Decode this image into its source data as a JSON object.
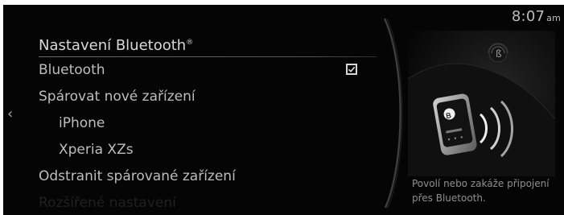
{
  "status": {
    "time": "8:07",
    "ampm": "am"
  },
  "left": {
    "back_icon": "chevron-left-icon"
  },
  "menu": {
    "title": "Nastavení Bluetooth",
    "title_superscript": "®",
    "items": [
      {
        "label": "Bluetooth",
        "checked": true
      },
      {
        "label": "Spárovat nové zařízení"
      },
      {
        "label": "iPhone"
      },
      {
        "label": "Xperia XZs"
      },
      {
        "label": "Odstranit spárované zařízení"
      },
      {
        "label": "Rozšířené nastavení"
      }
    ]
  },
  "help": {
    "description": "Povolí nebo zakáže připojení přes Bluetooth."
  },
  "colors": {
    "background": "#050505",
    "text": "#bdbdbd",
    "muted": "#8f8f8f"
  },
  "icons": {
    "checkbox": "checkbox-checked-icon",
    "illustration": "bluetooth-phone-illustration-icon"
  }
}
